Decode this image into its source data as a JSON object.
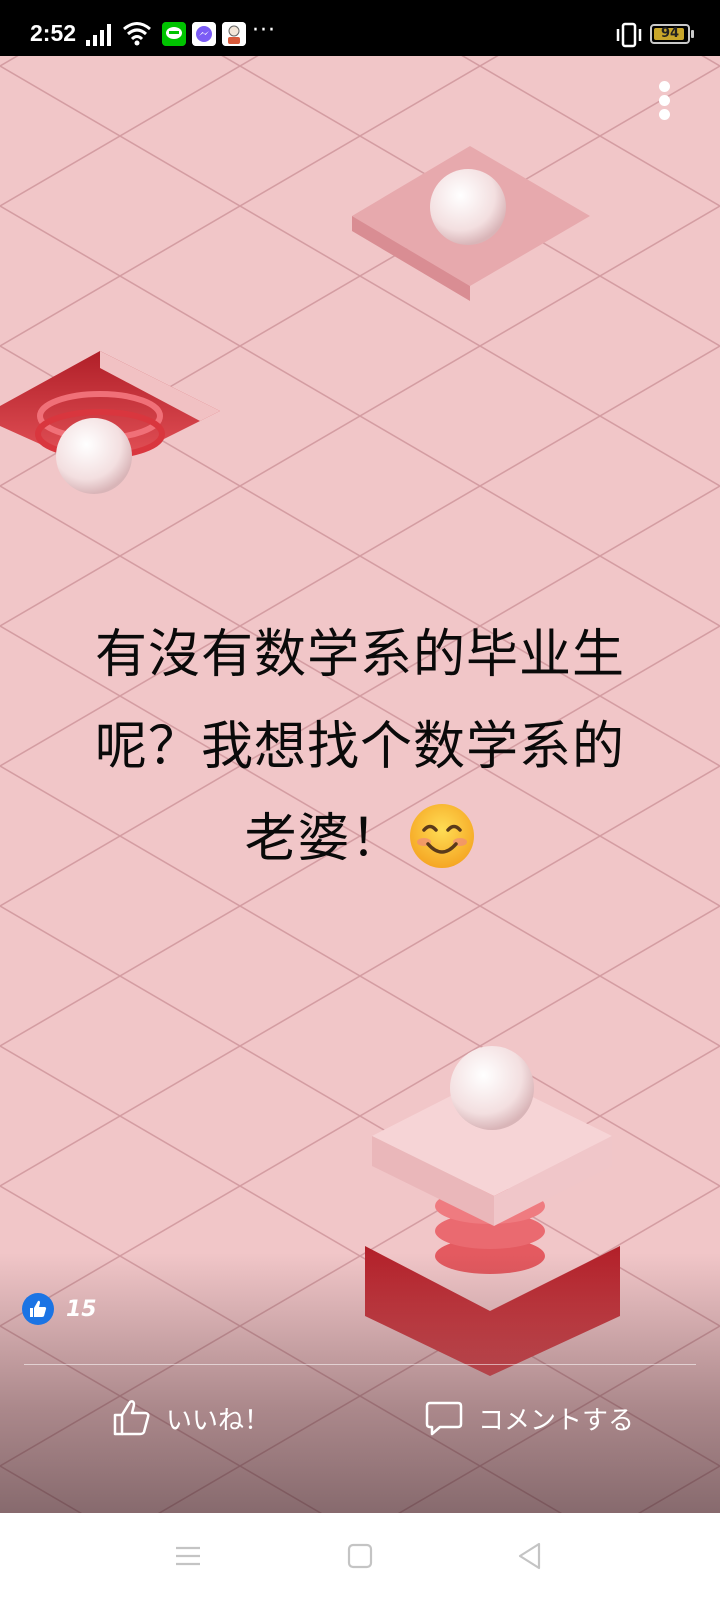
{
  "status_bar": {
    "time": "2:52",
    "battery_level": "94",
    "battery_percent": 94,
    "more_notifications": "···",
    "icons": [
      "signal-icon",
      "wifi-icon",
      "line-app-icon",
      "messenger-icon",
      "sticker-app-icon",
      "vibrate-icon",
      "battery-icon"
    ]
  },
  "post": {
    "text_lines": [
      "有沒有数学系的毕业生",
      "呢？我想找个数学系的",
      "老婆！"
    ],
    "emoji": "smiling-face-icon",
    "like_count": "15"
  },
  "actions": {
    "like_label": "いいね！",
    "comment_label": "コメントする"
  },
  "colors": {
    "like_blue": "#1b74e4",
    "background_pink": "#f0c4c6",
    "accent_red": "#d9363e"
  }
}
